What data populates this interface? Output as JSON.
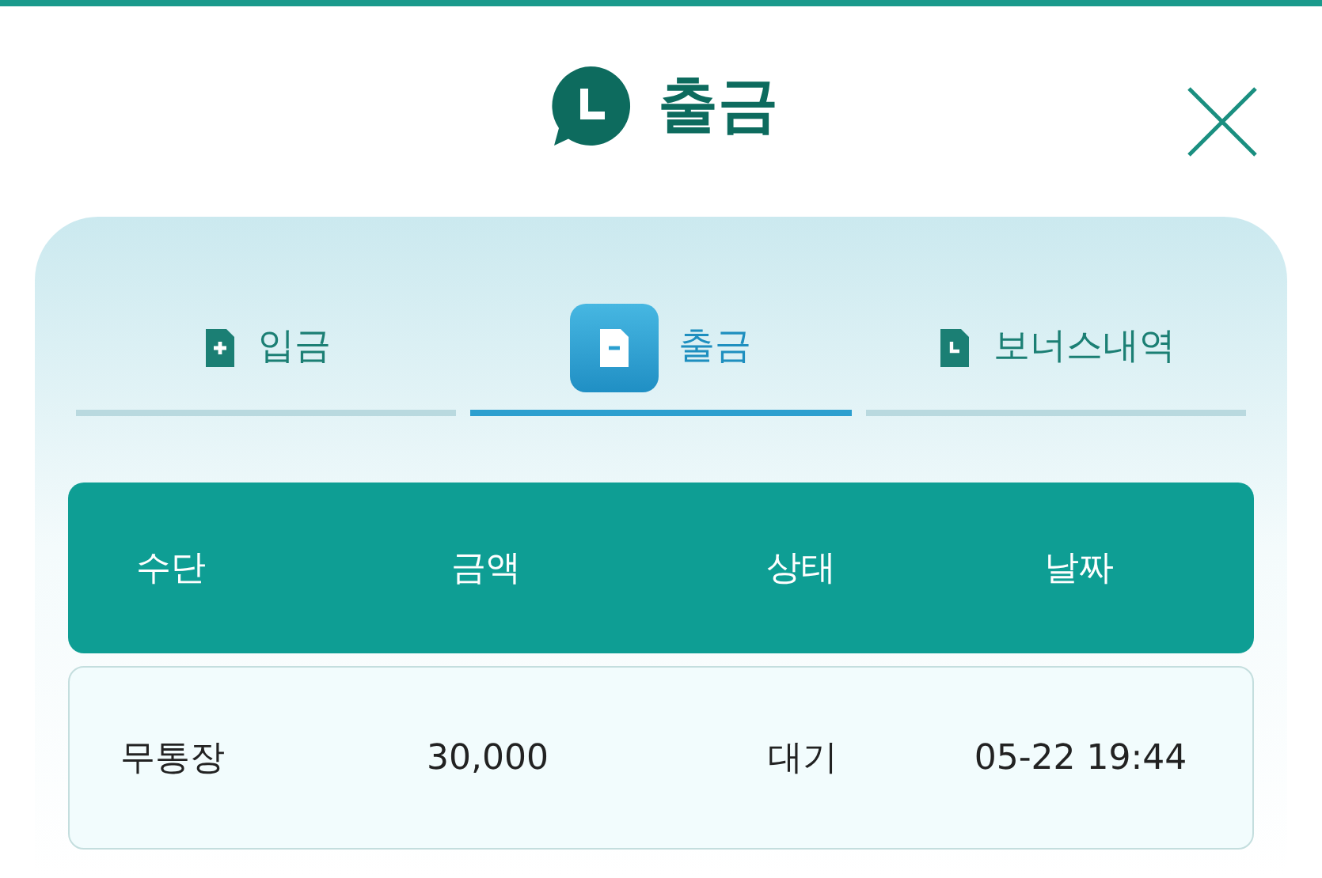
{
  "title": "출금",
  "tabs": [
    {
      "label": "입금",
      "selected": false,
      "kind": "deposit"
    },
    {
      "label": "출금",
      "selected": true,
      "kind": "withdraw"
    },
    {
      "label": "보너스내역",
      "selected": false,
      "kind": "bonus"
    }
  ],
  "table": {
    "columns": [
      "수단",
      "금액",
      "상태",
      "날짜"
    ],
    "rows": [
      [
        "무통장",
        "30,000",
        "대기",
        "05-22 19:44"
      ]
    ]
  }
}
